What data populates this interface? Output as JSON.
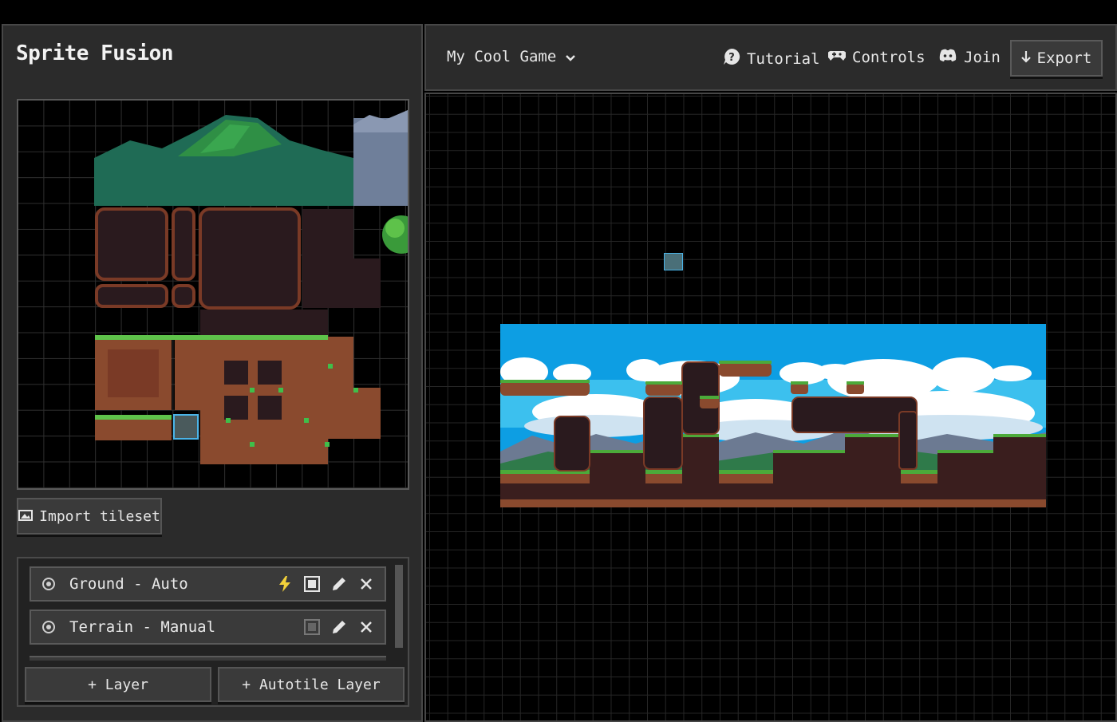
{
  "app": {
    "title": "Sprite Fusion"
  },
  "tileset_panel": {
    "import_label": "Import tileset"
  },
  "layers": {
    "items": [
      {
        "name": "Ground - Auto"
      },
      {
        "name": "Terrain - Manual"
      }
    ],
    "add_layer_label": "+ Layer",
    "add_autotile_label": "+ Autotile Layer"
  },
  "topbar": {
    "project_name": "My Cool Game",
    "tutorial_label": "Tutorial",
    "controls_label": "Controls",
    "join_label": "Join",
    "export_label": "Export"
  },
  "colors": {
    "panel_bg": "#2b2b2b",
    "canvas_bg": "#000000",
    "selection": "#4ab4e8",
    "autotile_icon": "#f2d13a",
    "dirt": "#8a4a2e",
    "grass": "#4caa3a",
    "sky": "#0d9ee3"
  },
  "icons": {
    "visibility": "eye-icon",
    "autotile": "lightning-icon",
    "edit": "pencil-icon",
    "delete": "close-icon",
    "import": "image-icon",
    "tutorial": "help-icon",
    "controls": "gamepad-icon",
    "join": "discord-icon",
    "export": "arrow-down-icon",
    "dropdown": "chevron-down-icon"
  }
}
